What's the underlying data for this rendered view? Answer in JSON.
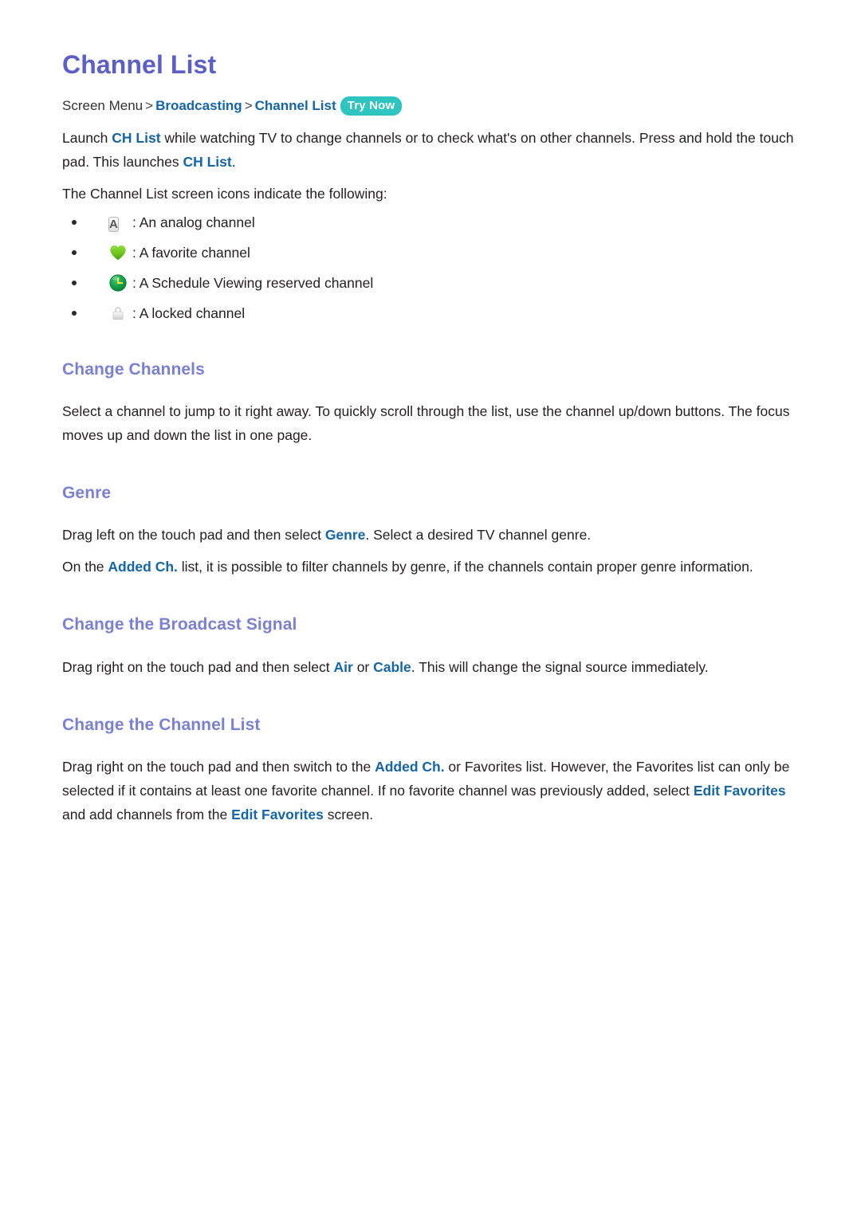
{
  "page": {
    "title": "Channel List"
  },
  "breadcrumb": {
    "root": "Screen Menu",
    "separator": ">",
    "level1": "Broadcasting",
    "level2": "Channel List",
    "badge": "Try Now"
  },
  "intro": {
    "p1_a": "Launch ",
    "p1_link1": "CH List",
    "p1_b": " while watching TV to change channels or to check what's on other channels. Press and hold the touch pad. This launches ",
    "p1_link2": "CH List",
    "p1_c": ".",
    "p2": "The Channel List screen icons indicate the following:"
  },
  "icon_list": [
    {
      "icon": "analog-a-icon",
      "icon_label": "A",
      "text": ": An analog channel"
    },
    {
      "icon": "favorite-heart-icon",
      "icon_label": "",
      "text": ": A favorite channel"
    },
    {
      "icon": "schedule-clock-icon",
      "icon_label": "",
      "text": ": A Schedule Viewing reserved channel"
    },
    {
      "icon": "locked-padlock-icon",
      "icon_label": "",
      "text": ": A locked channel"
    }
  ],
  "sections": {
    "change_channels": {
      "heading": "Change Channels",
      "p1": "Select a channel to jump to it right away. To quickly scroll through the list, use the channel up/down buttons. The focus moves up and down the list in one page."
    },
    "genre": {
      "heading": "Genre",
      "p1_a": "Drag left on the touch pad and then select ",
      "p1_link": "Genre",
      "p1_b": ". Select a desired TV channel genre.",
      "p2_a": "On the ",
      "p2_link": "Added Ch.",
      "p2_b": " list, it is possible to filter channels by genre, if the channels contain proper genre information."
    },
    "broadcast_signal": {
      "heading": "Change the Broadcast Signal",
      "p1_a": "Drag right on the touch pad and then select ",
      "p1_link1": "Air",
      "p1_b": " or ",
      "p1_link2": "Cable",
      "p1_c": ". This will change the signal source immediately."
    },
    "change_channel_list": {
      "heading": "Change the Channel List",
      "p1_a": "Drag right on the touch pad and then switch to the ",
      "p1_link1": "Added Ch.",
      "p1_b": " or Favorites list. However, the Favorites list can only be selected if it contains at least one favorite channel. If no favorite channel was previously added, select ",
      "p1_link2": "Edit Favorites",
      "p1_c": " and add channels from the ",
      "p1_link3": "Edit Favorites",
      "p1_d": " screen."
    }
  },
  "colors": {
    "title": "#5b5fc7",
    "section_heading": "#7b80d4",
    "link": "#1565a8",
    "badge_bg": "#2ec4c0",
    "body_text": "#231f20",
    "heart_green": "#6ec520",
    "clock_green": "#1aa84a",
    "clock_hand": "#e8e93c",
    "lock_gray": "#d9d9d9",
    "analog_gray": "#e2e2e2"
  }
}
